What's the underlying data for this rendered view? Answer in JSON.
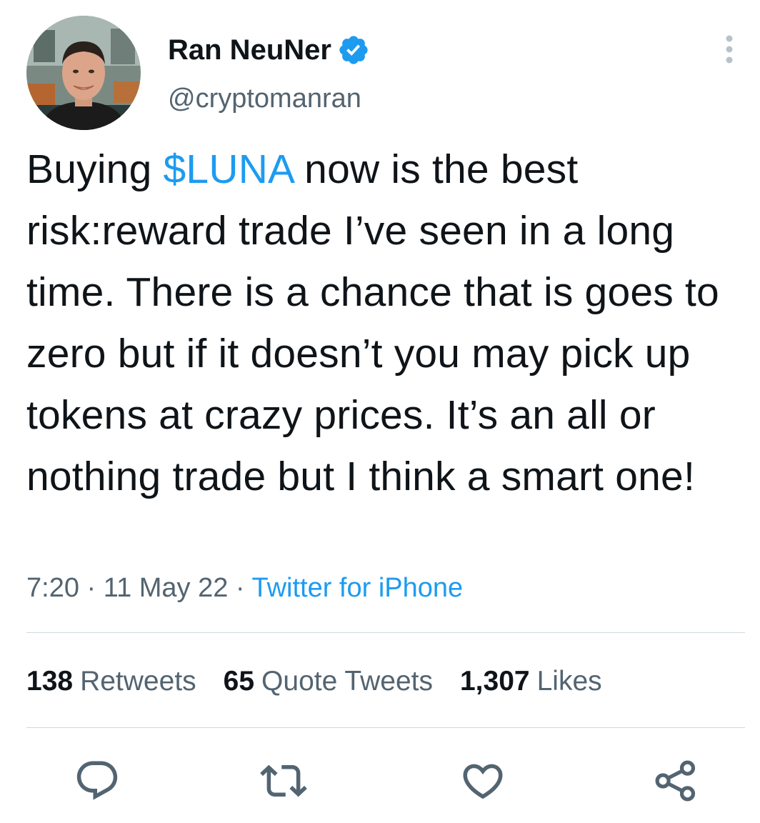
{
  "author": {
    "name": "Ran NeuNer",
    "handle": "@cryptomanran",
    "verified": true,
    "avatar_icon": "profile-photo-avatar",
    "verified_icon": "verified-badge-icon"
  },
  "tweet": {
    "text_prefix": "Buying ",
    "cashtag": "$LUNA",
    "text_suffix": " now is the best risk:reward trade I’ve seen in a long time. There is a chance that is goes to zero but if it doesn’t you may pick up tokens at crazy prices. It’s an all or nothing trade but I think a smart one!"
  },
  "meta": {
    "time": "7:20",
    "separator": " · ",
    "date": "11 May 22",
    "source": "Twitter for iPhone"
  },
  "stats": {
    "retweets": {
      "count": "138",
      "label": "Retweets"
    },
    "quotes": {
      "count": "65",
      "label": "Quote Tweets"
    },
    "likes": {
      "count": "1,307",
      "label": "Likes"
    }
  },
  "actions": [
    {
      "name": "reply",
      "icon": "reply-icon"
    },
    {
      "name": "retweet",
      "icon": "retweet-icon"
    },
    {
      "name": "like",
      "icon": "heart-icon"
    },
    {
      "name": "share",
      "icon": "share-icon"
    }
  ],
  "colors": {
    "text": "#0f1419",
    "secondary": "#536471",
    "accent": "#1d9bf0",
    "divider": "#cfd9de"
  }
}
